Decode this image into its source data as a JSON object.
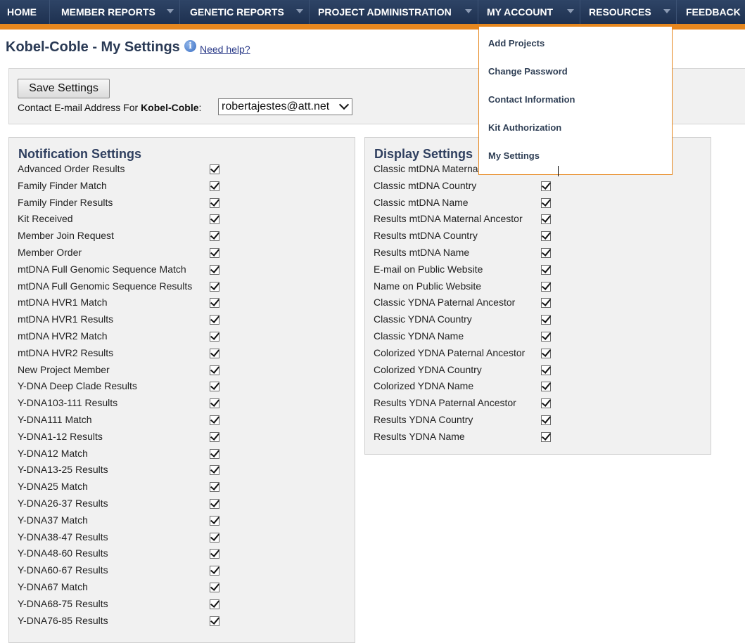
{
  "nav": [
    {
      "label": "HOME",
      "caret": false
    },
    {
      "label": "MEMBER REPORTS",
      "caret": true
    },
    {
      "label": "GENETIC REPORTS",
      "caret": true
    },
    {
      "label": "PROJECT ADMINISTRATION",
      "caret": true
    },
    {
      "label": "MY ACCOUNT",
      "caret": true
    },
    {
      "label": "RESOURCES",
      "caret": true
    },
    {
      "label": "FEEDBACK",
      "caret": false
    }
  ],
  "dropdown": [
    "Add Projects",
    "Change Password",
    "Contact Information",
    "Kit Authorization",
    "My Settings"
  ],
  "page": {
    "title": "Kobel-Coble - My Settings",
    "help": "Need help?",
    "info_icon": "info-icon"
  },
  "settings": {
    "save_label": "Save Settings",
    "email_label_prefix": "Contact E-mail Address For ",
    "email_label_project": "Kobel-Coble",
    "email_label_suffix": ":",
    "email_value": "robertajestes@att.net"
  },
  "notification": {
    "title": "Notification Settings",
    "items": [
      "Advanced Order Results",
      "Family Finder Match",
      "Family Finder Results",
      "Kit Received",
      "Member Join Request",
      "Member Order",
      "mtDNA Full Genomic Sequence Match",
      "mtDNA Full Genomic Sequence Results",
      "mtDNA HVR1 Match",
      "mtDNA HVR1 Results",
      "mtDNA HVR2 Match",
      "mtDNA HVR2 Results",
      "New Project Member",
      "Y-DNA Deep Clade Results",
      "Y-DNA103-111 Results",
      "Y-DNA111 Match",
      "Y-DNA1-12 Results",
      "Y-DNA12 Match",
      "Y-DNA13-25 Results",
      "Y-DNA25 Match",
      "Y-DNA26-37 Results",
      "Y-DNA37 Match",
      "Y-DNA38-47 Results",
      "Y-DNA48-60 Results",
      "Y-DNA60-67 Results",
      "Y-DNA67 Match",
      "Y-DNA68-75 Results",
      "Y-DNA76-85 Results"
    ]
  },
  "display": {
    "title": "Display Settings",
    "items": [
      "Classic mtDNA Maternal Ancestor",
      "Classic mtDNA Country",
      "Classic mtDNA Name",
      "Results mtDNA Maternal Ancestor",
      "Results mtDNA Country",
      "Results mtDNA Name",
      "E-mail on Public Website",
      "Name on Public Website",
      "Classic YDNA Paternal Ancestor",
      "Classic YDNA Country",
      "Classic YDNA Name",
      "Colorized YDNA Paternal Ancestor",
      "Colorized YDNA Country",
      "Colorized YDNA Name",
      "Results YDNA Paternal Ancestor",
      "Results YDNA Country",
      "Results YDNA Name"
    ]
  },
  "colors": {
    "nav": "#1e3150",
    "accent": "#e6871e",
    "title": "#2a3a55"
  }
}
